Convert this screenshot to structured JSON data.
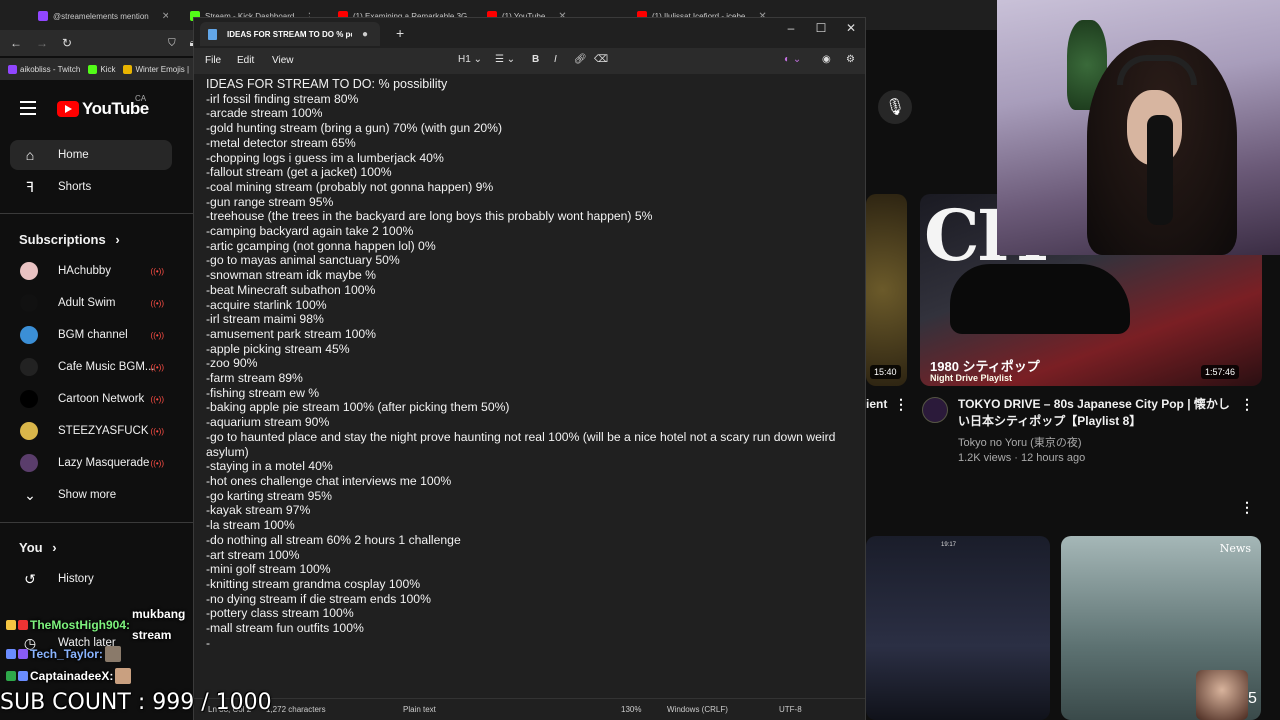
{
  "browser": {
    "tabs": [
      {
        "label": "@streamelements mention",
        "color": "#9146ff"
      },
      {
        "label": "Stream - Kick Dashboard",
        "color": "#53fc18"
      },
      {
        "label": "(1) Examining a Remarkable 3G",
        "color": "#ff0000"
      },
      {
        "label": "(1) YouTube",
        "color": "#ff0000"
      },
      {
        "label": "(1) Ilulissat Icefjord - icebe",
        "color": "#ff0000"
      }
    ],
    "bookmarks": [
      {
        "label": "aikobliss - Twitch",
        "color": "#9146ff"
      },
      {
        "label": "Kick",
        "color": "#53fc18"
      },
      {
        "label": "Winter Emojis |",
        "color": "#e8b400"
      }
    ]
  },
  "youtube": {
    "logo_text": "YouTube",
    "country": "CA",
    "nav": [
      {
        "label": "Home",
        "icon": "home-icon"
      },
      {
        "label": "Shorts",
        "icon": "shorts-icon"
      }
    ],
    "subscriptions_heading": "Subscriptions",
    "subscriptions": [
      {
        "label": "HAchubby",
        "avatar_color": "#e9c2c2"
      },
      {
        "label": "Adult Swim",
        "avatar_color": "#111111"
      },
      {
        "label": "BGM channel",
        "avatar_color": "#3b8fd6"
      },
      {
        "label": "Cafe Music BGM...",
        "avatar_color": "#222222"
      },
      {
        "label": "Cartoon Network",
        "avatar_color": "#000000"
      },
      {
        "label": "STEEZYASFUCK",
        "avatar_color": "#d9b64a"
      },
      {
        "label": "Lazy Masquerade",
        "avatar_color": "#5a3d6b"
      }
    ],
    "show_more": "Show more",
    "you_heading": "You",
    "you_items": [
      {
        "label": "History"
      },
      {
        "label": "Watch later"
      }
    ],
    "video": {
      "partial_title": "ient",
      "thumb_text": "CIT",
      "thumb_jp": "1980 シティポップ",
      "thumb_en": "Night Drive Playlist",
      "duration_left": "15:40",
      "duration_right": "1:57:46",
      "title": "TOKYO DRIVE – 80s Japanese City Pop | 懐かしい日本シティポップ【Playlist 8】",
      "channel": "Tokyo no Yoru (東京の夜)",
      "meta": "1.2K views · 12 hours ago"
    },
    "thumb3_time": "19:17",
    "thumb4_badge": "News"
  },
  "notepad": {
    "tab_title": "IDEAS FOR STREAM TO DO % possi",
    "menu": [
      "File",
      "Edit",
      "View"
    ],
    "heading_btn": "H1",
    "bold_btn": "B",
    "italic_btn": "I",
    "lines": [
      "IDEAS FOR STREAM TO DO: % possibility",
      "-irl fossil finding stream 80%",
      "-arcade stream 100%",
      "-gold hunting stream (bring a gun) 70% (with gun 20%)",
      "-metal detector stream 65%",
      "-chopping logs i guess im a lumberjack 40%",
      "-fallout stream (get a jacket) 100%",
      "-coal mining stream (probably not gonna happen) 9%",
      "-gun range stream 95%",
      "-treehouse (the trees in the backyard are long boys this probably wont happen) 5%",
      "-camping backyard again take 2 100%",
      "-artic gcamping (not gonna happen lol) 0%",
      "-go to mayas animal sanctuary 50%",
      "-snowman stream idk maybe %",
      "-beat Minecraft subathon 100%",
      "-acquire starlink 100%",
      "-irl stream maimi 98%",
      "-amusement park stream 100%",
      "-apple picking stream 45%",
      "-zoo 90%",
      "-farm stream 89%",
      "-fishing stream ew %",
      "-baking apple pie stream 100% (after picking them 50%)",
      "-aquarium stream 90%",
      "-go to haunted place and stay the night prove haunting not real 100% (will be a nice hotel not a scary run down weird asylum)",
      "-staying in a motel 40%",
      "-hot ones challenge chat interviews me 100%",
      "-go karting stream 95%",
      "-kayak stream 97%",
      "-la stream 100%",
      "-do nothing all stream 60% 2 hours 1 challenge",
      "-art stream 100%",
      "-mini golf stream 100%",
      "-knitting stream grandma cosplay 100%",
      "-no dying stream if die stream ends 100%",
      "-pottery class stream 100%",
      "-mall stream fun outfits 100%",
      "-"
    ],
    "status": {
      "position": "Ln 38, Col 2",
      "chars": "1,272 characters",
      "format": "Plain text",
      "zoom": "130%",
      "line_ending": "Windows (CRLF)",
      "encoding": "UTF-8"
    }
  },
  "chat": [
    {
      "user": "TheMostHigh904:",
      "message": "mukbang stream",
      "user_color": "#7df27d"
    },
    {
      "user": "Tech_Taylor:",
      "message": "",
      "user_color": "#8ab4ff"
    },
    {
      "user": "CaptainadeeX:",
      "message": "",
      "user_color": "#ffffff"
    }
  ],
  "overlay": {
    "sub_count": "SUB COUNT : 999 / 1000",
    "corner_number": "5"
  }
}
